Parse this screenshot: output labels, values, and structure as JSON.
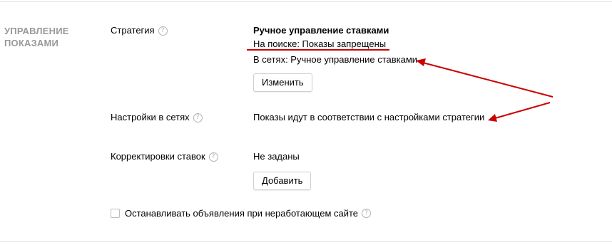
{
  "section": {
    "title": "УПРАВЛЕНИЕ ПОКАЗАМИ"
  },
  "strategy": {
    "label": "Стратегия",
    "name": "Ручное управление ставками",
    "search": "На поиске: Показы запрещены",
    "networks": "В сетях: Ручное управление ставками",
    "change_button": "Изменить"
  },
  "network_settings": {
    "label": "Настройки в сетях",
    "value": "Показы идут в соответствии с настройками стратегии"
  },
  "bid_adjustments": {
    "label": "Корректировки ставок",
    "value": "Не заданы",
    "add_button": "Добавить"
  },
  "stop_ads": {
    "label": "Останавливать объявления при неработающем сайте",
    "checked": false
  },
  "help_glyph": "?",
  "colors": {
    "annotation": "#cc0000",
    "section_title": "#999999"
  }
}
